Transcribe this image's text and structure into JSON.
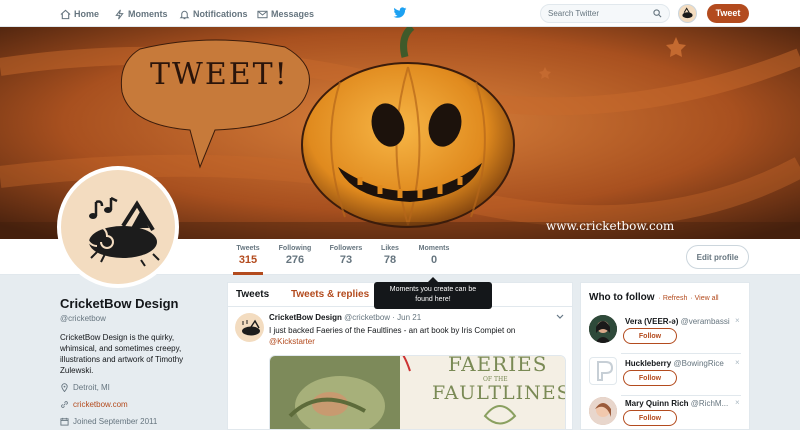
{
  "nav": {
    "home": "Home",
    "moments": "Moments",
    "notifications": "Notifications",
    "messages": "Messages",
    "search_placeholder": "Search Twitter",
    "tweet_button": "Tweet"
  },
  "banner": {
    "bubble_text": "TWEET!",
    "url_text": "www.cricketbow.com"
  },
  "stats": [
    {
      "label": "Tweets",
      "value": "315"
    },
    {
      "label": "Following",
      "value": "276"
    },
    {
      "label": "Followers",
      "value": "73"
    },
    {
      "label": "Likes",
      "value": "78"
    },
    {
      "label": "Moments",
      "value": "0"
    }
  ],
  "edit_profile": "Edit profile",
  "tooltip": {
    "line1": "Moments you create can be",
    "line2": "found here!"
  },
  "profile": {
    "name": "CricketBow Design",
    "handle": "@cricketbow",
    "bio": "CricketBow Design is the quirky, whimsical, and sometimes creepy, illustrations and artwork of Timothy Zulewski.",
    "location": "Detroit, MI",
    "website": "cricketbow.com",
    "joined": "Joined September 2011"
  },
  "timeline": {
    "tabs": [
      "Tweets",
      "Tweets & replies"
    ],
    "tweet": {
      "name": "CricketBow Design",
      "handle": "@cricketbow",
      "date": "· Jun 21",
      "text": "I just backed Faeries of the Faultlines - an art book by Iris Compiet on",
      "link": "@Kickstarter",
      "media_title_1": "FAERIES",
      "media_title_2": "OF THE",
      "media_title_3": "FAULTLINES"
    }
  },
  "who_to_follow": {
    "title": "Who to follow",
    "refresh": "· Refresh",
    "view_all": "· View all",
    "follow_label": "Follow",
    "close_glyph": "×",
    "users": [
      {
        "name": "Vera (VEER-ə)",
        "handle": "@verambassi"
      },
      {
        "name": "Huckleberry",
        "handle": "@BowingRice"
      },
      {
        "name": "Mary Quinn Rich",
        "handle": "@RichM..."
      }
    ]
  },
  "colors": {
    "accent": "#b34b1e",
    "twitter_blue": "#1da1f2"
  }
}
